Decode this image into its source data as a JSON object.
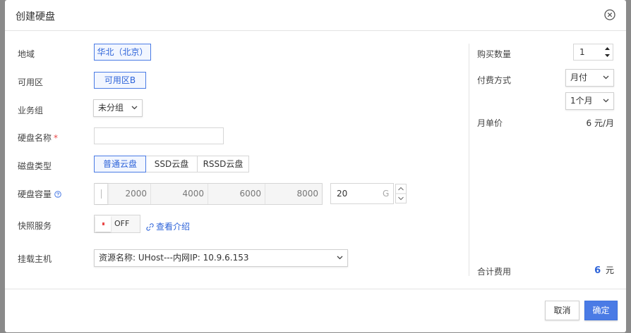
{
  "dialog": {
    "title": "创建硬盘",
    "close_icon": "close-circle-icon"
  },
  "form": {
    "region": {
      "label": "地域",
      "value": "华北（北京）"
    },
    "zone": {
      "label": "可用区",
      "value": "可用区B"
    },
    "group": {
      "label": "业务组",
      "value": "未分组"
    },
    "disk_name": {
      "label": "硬盘名称",
      "required_mark": "*",
      "value": "",
      "placeholder": ""
    },
    "disk_type": {
      "label": "磁盘类型",
      "options": [
        "普通云盘",
        "SSD云盘",
        "RSSD云盘"
      ],
      "selected": "普通云盘"
    },
    "capacity": {
      "label": "硬盘容量",
      "help_icon": "question-circle-icon",
      "ticks": [
        "2000",
        "4000",
        "6000",
        "8000"
      ],
      "value": "20",
      "unit": "G",
      "slider_fraction": 0.0
    },
    "snapshot": {
      "label": "快照服务",
      "toggle_state": "OFF",
      "link_label": "查看介绍",
      "link_icon": "link-icon"
    },
    "host": {
      "label": "挂载主机",
      "value": "资源名称: UHost---内网IP: 10.9.6.153"
    }
  },
  "summary": {
    "quantity": {
      "label": "购买数量",
      "value": "1"
    },
    "billing": {
      "label": "付费方式",
      "mode": "月付",
      "period": "1个月"
    },
    "unit_price": {
      "label": "月单价",
      "value": "6 元/月"
    },
    "total": {
      "label": "合计费用",
      "amount": "6",
      "unit": "元"
    }
  },
  "footer": {
    "cancel_label": "取消",
    "ok_label": "确定"
  },
  "colors": {
    "accent": "#4a7be5",
    "accent_text": "#2d63d9",
    "required": "#e94848"
  }
}
